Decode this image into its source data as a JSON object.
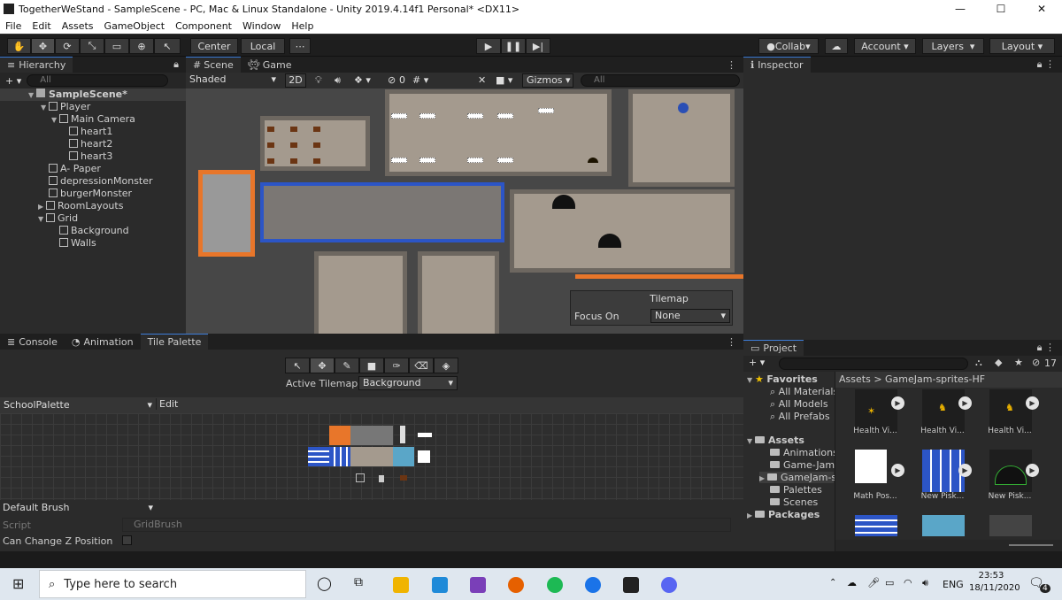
{
  "window": {
    "title": "TogetherWeStand - SampleScene - PC, Mac & Linux Standalone - Unity 2019.4.14f1 Personal* <DX11>",
    "minimize": "—",
    "maximize": "☐",
    "close": "✕"
  },
  "menu": [
    "File",
    "Edit",
    "Assets",
    "GameObject",
    "Component",
    "Window",
    "Help"
  ],
  "toolbar": {
    "center": "Center",
    "local": "Local",
    "collab": "Collab",
    "account": "Account",
    "layers": "Layers",
    "layout": "Layout"
  },
  "hierarchy": {
    "tab": "Hierarchy",
    "search_placeholder": "All",
    "scene": "SampleScene*",
    "items": [
      "Player",
      "Main Camera",
      "heart1",
      "heart2",
      "heart3",
      "A- Paper",
      "depressionMonster",
      "burgerMonster",
      "RoomLayouts",
      "Grid",
      "Background",
      "Walls"
    ]
  },
  "scene": {
    "tab": "Scene",
    "game_tab": "Game",
    "shading": "Shaded",
    "mode2d": "2D",
    "hidden_count": "0",
    "gizmos": "Gizmos",
    "search_placeholder": "All"
  },
  "tilemap_overlay": {
    "title": "Tilemap",
    "focus_label": "Focus On",
    "focus_value": "None"
  },
  "inspector": {
    "tab": "Inspector"
  },
  "bottom_tabs": {
    "console": "Console",
    "animation": "Animation",
    "tile_palette": "Tile Palette"
  },
  "palette": {
    "active_label": "Active Tilemap",
    "active_value": "Background",
    "palette_name": "SchoolPalette",
    "edit": "Edit",
    "brush": "Default Brush",
    "script_label": "Script",
    "script_value": "GridBrush",
    "zpos_label": "Can Change Z Position"
  },
  "project": {
    "tab": "Project",
    "count": "17",
    "favorites": "Favorites",
    "fav_items": [
      "All Materials",
      "All Models",
      "All Prefabs"
    ],
    "assets": "Assets",
    "folders": [
      "Animations",
      "Game-Jam-...",
      "GameJam-s...",
      "Palettes",
      "Scenes"
    ],
    "packages": "Packages",
    "breadcrumb_root": "Assets",
    "breadcrumb_sep": ">",
    "breadcrumb_current": "GameJam-sprites-HF",
    "thumbs": [
      "Health Vi...",
      "Health Vi...",
      "Health Vi...",
      "Math Pos...",
      "New Pisk...",
      "New Pisk..."
    ]
  },
  "taskbar": {
    "search_placeholder": "Type here to search",
    "lang": "ENG",
    "time": "23:53",
    "date": "18/11/2020",
    "notif_count": "4"
  }
}
